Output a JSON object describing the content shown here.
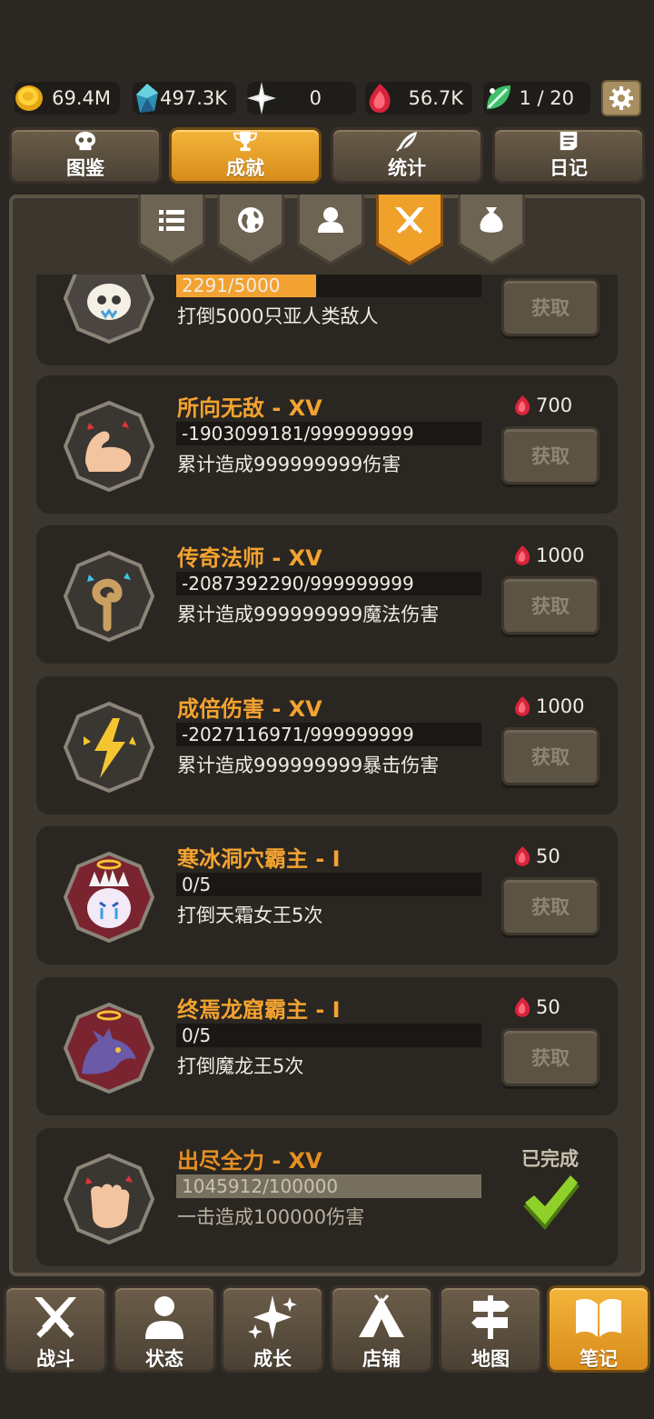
{
  "resources": [
    {
      "name": "gold-coin-icon",
      "value": "69.4M"
    },
    {
      "name": "crystal-icon",
      "value": "497.3K"
    },
    {
      "name": "star-shard-icon",
      "value": "0"
    },
    {
      "name": "red-gem-icon",
      "value": "56.7K"
    },
    {
      "name": "leaf-gem-icon",
      "value": "1 / 20"
    }
  ],
  "top_tabs": [
    {
      "label": "图鉴",
      "icon": "skull-icon",
      "active": false
    },
    {
      "label": "成就",
      "icon": "trophy-icon",
      "active": true
    },
    {
      "label": "统计",
      "icon": "quill-icon",
      "active": false
    },
    {
      "label": "日记",
      "icon": "diary-icon",
      "active": false
    }
  ],
  "sub_tabs": [
    {
      "icon": "list-icon",
      "active": false
    },
    {
      "icon": "globe-icon",
      "active": false
    },
    {
      "icon": "person-icon",
      "active": false
    },
    {
      "icon": "crossed-swords-icon",
      "active": true
    },
    {
      "icon": "loot-bag-icon",
      "active": false
    }
  ],
  "achievements": [
    {
      "title": "",
      "progress": "2291/5000",
      "fill": 0.458,
      "desc": "打倒5000只亚人类敌人",
      "reward": "",
      "button": "获取",
      "badge": "skull-badge-icon",
      "done": false
    },
    {
      "title": "所向无敌 - XV",
      "progress": "-1903099181/999999999",
      "fill": 0,
      "desc": "累计造成999999999伤害",
      "reward": "700",
      "button": "获取",
      "badge": "muscle-badge-icon",
      "done": false
    },
    {
      "title": "传奇法师 - XV",
      "progress": "-2087392290/999999999",
      "fill": 0,
      "desc": "累计造成999999999魔法伤害",
      "reward": "1000",
      "button": "获取",
      "badge": "staff-badge-icon",
      "done": false
    },
    {
      "title": "成倍伤害 - XV",
      "progress": "-2027116971/999999999",
      "fill": 0,
      "desc": "累计造成999999999暴击伤害",
      "reward": "1000",
      "button": "获取",
      "badge": "lightning-badge-icon",
      "done": false
    },
    {
      "title": "寒冰洞穴霸主 - I",
      "progress": "0/5",
      "fill": 0,
      "desc": "打倒天霜女王5次",
      "reward": "50",
      "button": "获取",
      "badge": "frost-queen-badge-icon",
      "done": false
    },
    {
      "title": "终焉龙窟霸主 - I",
      "progress": "0/5",
      "fill": 0,
      "desc": "打倒魔龙王5次",
      "reward": "50",
      "button": "获取",
      "badge": "dragon-badge-icon",
      "done": false
    },
    {
      "title": "出尽全力 - XV",
      "progress": "1045912/100000",
      "fill": 1,
      "desc": "一击造成100000伤害",
      "reward": "",
      "button": "",
      "done_label": "已完成",
      "badge": "fist-badge-icon",
      "done": true
    }
  ],
  "bottom_nav": [
    {
      "label": "战斗",
      "icon": "battle-swords-icon",
      "active": false
    },
    {
      "label": "状态",
      "icon": "status-person-icon",
      "active": false
    },
    {
      "label": "成长",
      "icon": "growth-sparkle-icon",
      "active": false
    },
    {
      "label": "店铺",
      "icon": "shop-tent-icon",
      "active": false
    },
    {
      "label": "地图",
      "icon": "signpost-icon",
      "active": false
    },
    {
      "label": "笔记",
      "icon": "open-book-icon",
      "active": true
    }
  ],
  "colors": {
    "accent": "#f3a330",
    "panel": "#3b362e",
    "card": "#2a2621",
    "button": "#5b5343"
  }
}
